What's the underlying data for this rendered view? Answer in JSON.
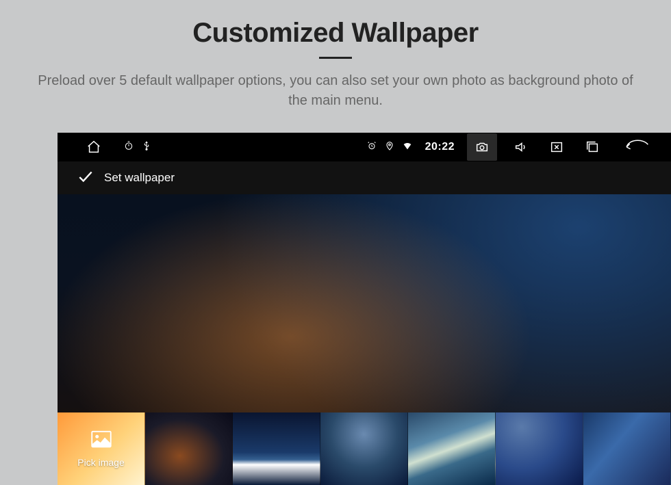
{
  "header": {
    "title": "Customized Wallpaper",
    "subtitle": "Preload over 5 default wallpaper options, you can also set your own photo as background photo of the main menu."
  },
  "statusbar": {
    "time": "20:22",
    "icons": {
      "home": "home-icon",
      "timer": "timer-icon",
      "usb": "usb-icon",
      "alarm": "alarm-icon",
      "location": "location-icon",
      "wifi": "wifi-icon",
      "camera": "camera-icon",
      "volume": "volume-icon",
      "close_box": "close-box-icon",
      "recents": "recents-icon",
      "back": "back-icon"
    }
  },
  "actionbar": {
    "confirm_label": "Set wallpaper"
  },
  "thumbs": {
    "pick_label": "Pick image",
    "items": [
      {
        "name": "wallpaper-1"
      },
      {
        "name": "wallpaper-2"
      },
      {
        "name": "wallpaper-3"
      },
      {
        "name": "wallpaper-4"
      },
      {
        "name": "wallpaper-5"
      },
      {
        "name": "wallpaper-6"
      },
      {
        "name": "wallpaper-7"
      }
    ]
  }
}
